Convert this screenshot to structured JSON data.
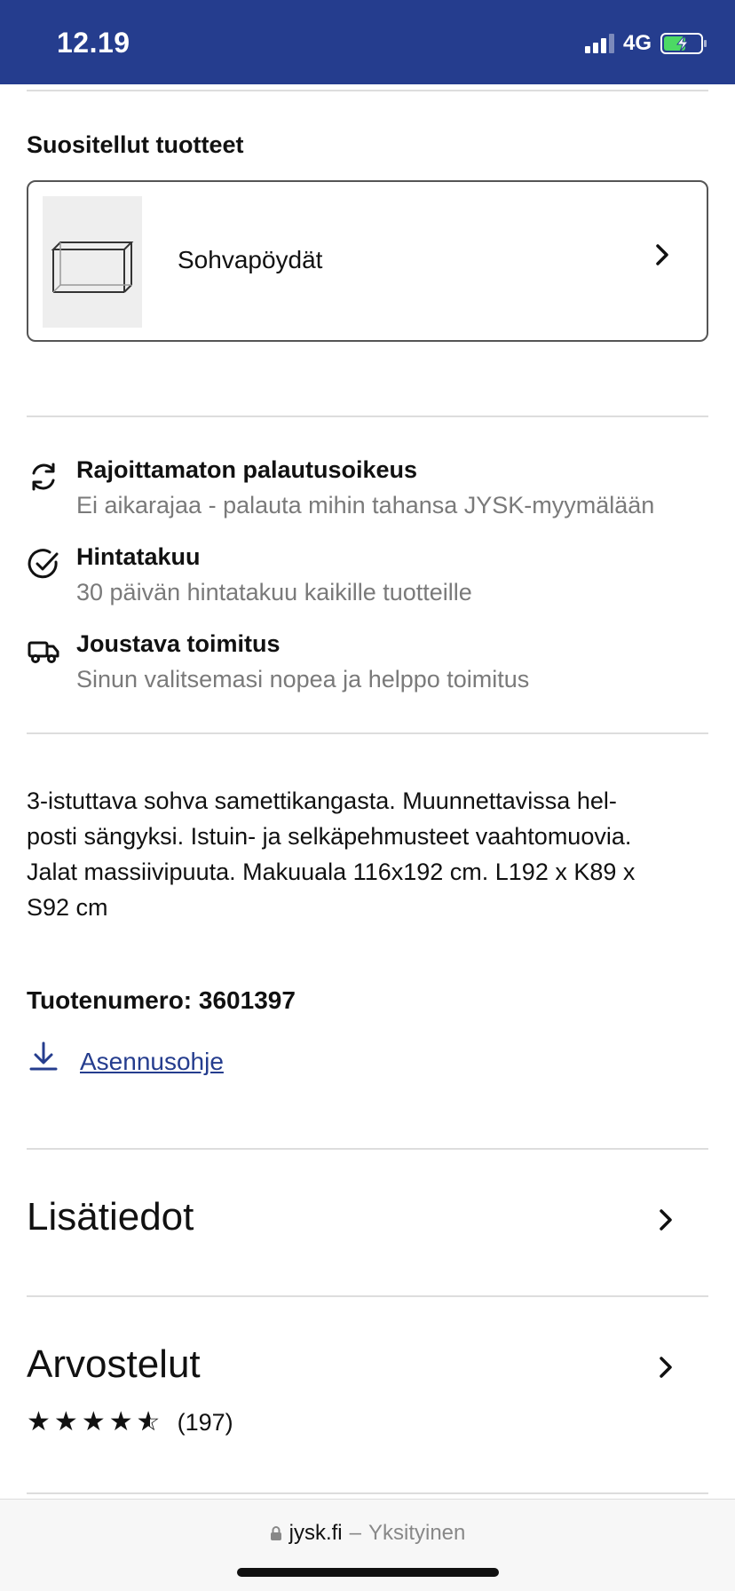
{
  "status_bar": {
    "time": "12.19",
    "network": "4G"
  },
  "recommended": {
    "heading": "Suositellut tuotteet",
    "item_label": "Sohvapöydät"
  },
  "usps": [
    {
      "icon": "refresh-icon",
      "title": "Rajoittamaton palautusoikeus",
      "subtitle": "Ei aikarajaa - palauta mihin tahansa JYSK-myymälään"
    },
    {
      "icon": "check-circle-icon",
      "title": "Hintatakuu",
      "subtitle": "30 päivän hintatakuu kaikille tuotteille"
    },
    {
      "icon": "delivery-truck-icon",
      "title": "Joustava toimitus",
      "subtitle": "Sinun valitsemasi nopea ja helppo toimitus"
    }
  ],
  "description": {
    "lines": [
      "3-istuttava sohva samettikangasta. Muunnettavissa hel-",
      "posti sängyksi. Istuin- ja selkäpehmusteet vaahtomuovia.",
      "Jalat massiivipuuta. Makuuala 116x192 cm. L192 x K89 x",
      "S92 cm"
    ]
  },
  "product_number": "Tuotenumero: 3601397",
  "manual_link": "Asennusohje",
  "accordions": {
    "details_label": "Lisätiedot",
    "reviews_label": "Arvostelut"
  },
  "reviews": {
    "rating": 4.5,
    "max_rating": 5,
    "count": "(197)"
  },
  "browser": {
    "domain": "jysk.fi",
    "separator": "–",
    "mode": "Yksityinen"
  }
}
